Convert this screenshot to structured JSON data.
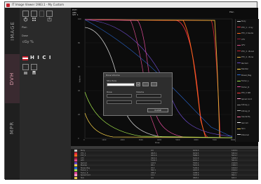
{
  "window": {
    "title": "IT Image Viewer  1983.1 - My Custom"
  },
  "tabs": [
    {
      "label": "IMAGE",
      "active": false
    },
    {
      "label": "DVH",
      "active": true
    },
    {
      "label": "MPR",
      "active": false
    }
  ],
  "panel": {
    "label_1": "Plan",
    "label_2": "Dose",
    "units_label": "cGy  %",
    "logo_text": "H I C I"
  },
  "plot": {
    "header_lines": [
      "DVH",
      "ABS",
      "SET 1"
    ],
    "header_right": "Plan",
    "y_axis_label": "Volume",
    "x_axis_label": "Dose",
    "x_ticks": [
      "0",
      "1000",
      "2000",
      "3000",
      "4000",
      "5000",
      "6000",
      "7000",
      "8000"
    ],
    "y_ticks": [
      "100",
      "80",
      "60",
      "40",
      "20",
      "0"
    ]
  },
  "legend": {
    "items": [
      {
        "label": "Body",
        "color": "#c8c8c8"
      },
      {
        "label": "PTV_1 - 2 Gy",
        "color": "#e02a3a"
      },
      {
        "label": "PTV_2 Cauda",
        "color": "#ff6a1a"
      },
      {
        "label": "CTV",
        "color": "#9b1a3a"
      },
      {
        "label": "GTV",
        "color": "#d84a8a"
      },
      {
        "label": "PTV_3 - Boost",
        "color": "#c8202e"
      },
      {
        "label": "PTV_4 - Bone",
        "color": "#e8b23a"
      },
      {
        "label": "Rectum",
        "color": "#6a4ac8"
      },
      {
        "label": "Bladder",
        "color": "#ffd84a"
      },
      {
        "label": "Bowel_Bag",
        "color": "#2a6ad8"
      },
      {
        "label": "Femur_L",
        "color": "#a0e04a"
      },
      {
        "label": "Femur_R",
        "color": "#e04a9a"
      },
      {
        "label": "PTV_5 SIB",
        "color": "#ff3a3a"
      },
      {
        "label": "Spinal Cord",
        "color": "#ff9acd"
      },
      {
        "label": "Kidney_L",
        "color": "#8a8a8a"
      },
      {
        "label": "Kidney_R",
        "color": "#aaaaaa"
      },
      {
        "label": "Cauda Eq",
        "color": "#ff6fa0"
      },
      {
        "label": "Sacrum",
        "color": "#f0f0f0"
      },
      {
        "label": "Skin",
        "color": "#e8c84a"
      },
      {
        "label": "External",
        "color": "#d0d0d0"
      }
    ]
  },
  "dialog": {
    "title": "Dose Volume",
    "section_label": "Structure",
    "select_value": "",
    "label_a": "Dose",
    "label_b": "Volume",
    "ok_label": "CLOSE"
  },
  "table": {
    "rows": [
      {
        "name": "Body",
        "min": "0.0",
        "max": "6234.5",
        "mean": "1203.4",
        "color": "#c8c8c8"
      },
      {
        "name": "PTV_1",
        "min": "4823.1",
        "max": "6234.5",
        "mean": "5410.2",
        "color": "#e02a3a"
      },
      {
        "name": "PTV_2",
        "min": "4012.6",
        "max": "5986.3",
        "mean": "5021.7",
        "color": "#ff6a1a"
      },
      {
        "name": "CTV",
        "min": "4910.4",
        "max": "6110.9",
        "mean": "5488.0",
        "color": "#9b1a3a"
      },
      {
        "name": "GTV",
        "min": "5102.3",
        "max": "6201.1",
        "mean": "5612.4",
        "color": "#d84a8a"
      },
      {
        "name": "Rectum",
        "min": "120.5",
        "max": "5320.2",
        "mean": "2140.6",
        "color": "#6a4ac8"
      },
      {
        "name": "Bladder",
        "min": "98.2",
        "max": "5401.8",
        "mean": "1980.3",
        "color": "#ffd84a"
      },
      {
        "name": "Bowel_Bag",
        "min": "45.0",
        "max": "5100.4",
        "mean": "1604.9",
        "color": "#2a6ad8"
      },
      {
        "name": "Femur_L",
        "min": "302.1",
        "max": "4210.5",
        "mean": "1540.2",
        "color": "#a0e04a"
      },
      {
        "name": "Femur_R",
        "min": "298.4",
        "max": "4188.9",
        "mean": "1522.7",
        "color": "#e04a9a"
      },
      {
        "name": "Spinal Cord",
        "min": "12.4",
        "max": "3120.8",
        "mean": "890.1",
        "color": "#ff9acd"
      },
      {
        "name": "Skin",
        "min": "0.0",
        "max": "4820.1",
        "mean": "620.3",
        "color": "#e8c84a"
      }
    ]
  }
}
